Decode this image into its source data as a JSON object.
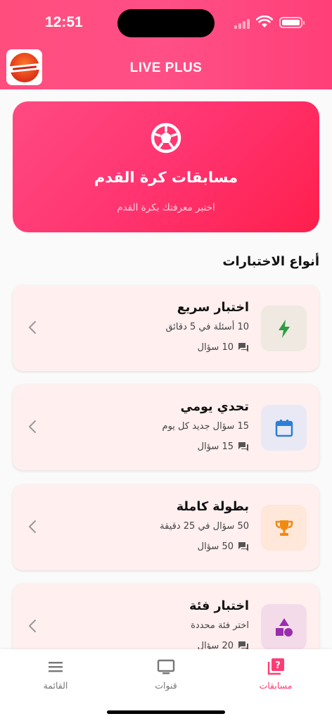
{
  "status_bar": {
    "time": "12:51"
  },
  "header": {
    "title": "LIVE PLUS"
  },
  "hero": {
    "title": "مسابقات كرة القدم",
    "subtitle": "اختبر معرفتك بكرة القدم"
  },
  "section": {
    "title": "أنواع الاختبارات"
  },
  "quizzes": [
    {
      "name": "اختبار سريع",
      "desc": "10 أسئلة في 5 دقائق",
      "count": "10 سؤال",
      "icon": "bolt-icon",
      "tile_color": "#efe9e1",
      "icon_color": "#2e9d43"
    },
    {
      "name": "تحدي يومي",
      "desc": "15 سؤال جديد كل يوم",
      "count": "15 سؤال",
      "icon": "calendar-icon",
      "tile_color": "#e9e9f5",
      "icon_color": "#2b7fd6"
    },
    {
      "name": "بطولة كاملة",
      "desc": "50 سؤال في 25 دقيقة",
      "count": "50 سؤال",
      "icon": "trophy-icon",
      "tile_color": "#ffe7d9",
      "icon_color": "#f08a11"
    },
    {
      "name": "اختبار فئة",
      "desc": "اختر فئة محددة",
      "count": "20 سؤال",
      "icon": "shapes-icon",
      "tile_color": "#f3dbe9",
      "icon_color": "#9a2cae"
    }
  ],
  "nav": {
    "menu": "القائمة",
    "channels": "قنوات",
    "quizzes": "مسابقات"
  },
  "colors": {
    "accent": "#ff3d74",
    "header": "#ff4d7e"
  }
}
